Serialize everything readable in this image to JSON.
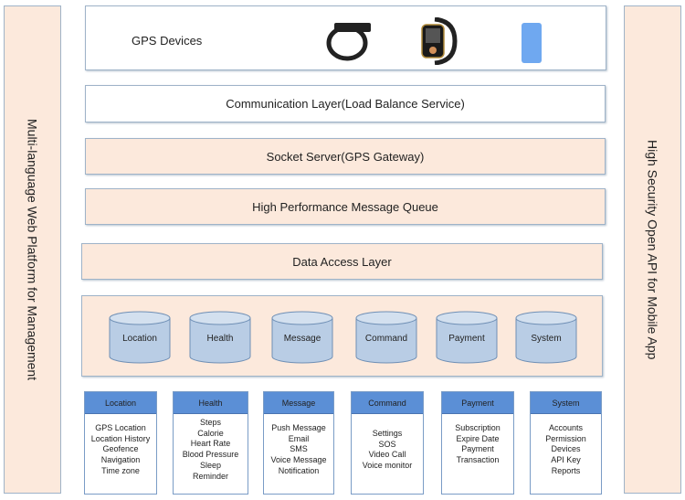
{
  "left_panel": {
    "label": "Multi-language Web Platform for Management"
  },
  "right_panel": {
    "label": "High Security Open API for Mobile App"
  },
  "devices": {
    "label": "GPS Devices",
    "icons": [
      "wristband-icon",
      "smartwatch-icon",
      "gps-tracker-icon"
    ]
  },
  "layers": {
    "communication": "Communication Layer(Load Balance Service)",
    "socket": "Socket Server(GPS Gateway)",
    "queue": "High Performance Message Queue",
    "data_access": "Data Access Layer"
  },
  "databases": [
    "Location",
    "Health",
    "Message",
    "Command",
    "Payment",
    "System"
  ],
  "modules": [
    {
      "title": "Location",
      "items": [
        "GPS Location",
        "Location History",
        "Geofence",
        "Navigation",
        "Time zone"
      ],
      "pad": 10
    },
    {
      "title": "Health",
      "items": [
        "Steps",
        "Calorie",
        "Heart Rate",
        "Blood Pressure",
        "Sleep",
        "Reminder"
      ],
      "pad": 4
    },
    {
      "title": "Message",
      "items": [
        "Push Message",
        "Email",
        "SMS",
        "Voice Message",
        "Notification"
      ],
      "pad": 10
    },
    {
      "title": "Command",
      "items": [
        "Settings",
        "SOS",
        "Video Call",
        "Voice monitor"
      ],
      "pad": 16
    },
    {
      "title": "Payment",
      "items": [
        "Subscription",
        "Expire Date",
        "Payment",
        "Transaction"
      ],
      "pad": 10
    },
    {
      "title": "System",
      "items": [
        "Accounts",
        "Permission",
        "Devices",
        "API Key",
        "Reports"
      ],
      "pad": 10
    }
  ],
  "colors": {
    "peach": "#fce9dc",
    "header_blue": "#5b8fd6",
    "cylinder": "#b9cde5",
    "border": "#9fb3c8"
  }
}
